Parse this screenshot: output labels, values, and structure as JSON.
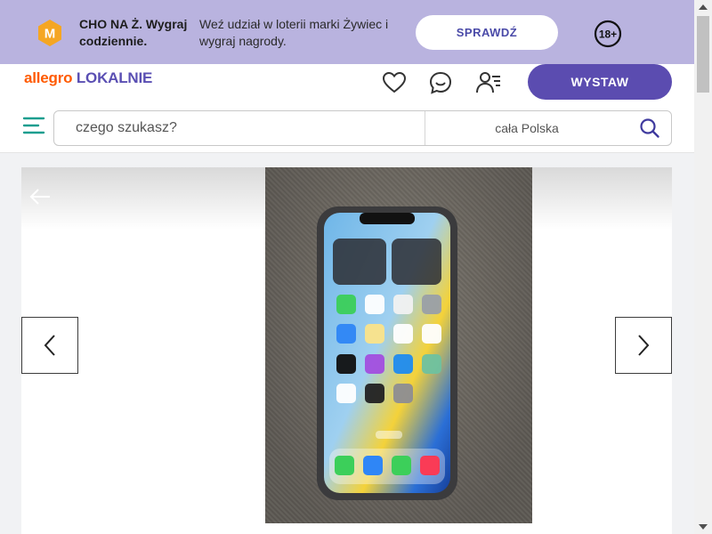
{
  "promo": {
    "title": "CHO NA Ż. Wygraj codziennie.",
    "description": "Weź udział w loterii marki Żywiec i wygraj nagrody.",
    "button_label": "SPRAWDŹ",
    "logo_letter": "M",
    "age_label": "18+",
    "colors": {
      "background": "#b9b3df",
      "logo": "#f5a623"
    }
  },
  "header": {
    "logo_part1": "allegro",
    "logo_part2": "LOKALNIE",
    "icons": [
      "heart-icon",
      "chat-icon",
      "user-menu-icon"
    ],
    "sell_button_label": "WYSTAW",
    "colors": {
      "brand_orange": "#ff5a00",
      "brand_purple": "#5b4cb0"
    }
  },
  "search": {
    "placeholder": "czego szukasz?",
    "location": "cała Polska"
  },
  "gallery": {
    "image_alt": "iPhone",
    "icons": [
      "back-arrow-icon",
      "chevron-left-icon",
      "chevron-right-icon"
    ]
  }
}
